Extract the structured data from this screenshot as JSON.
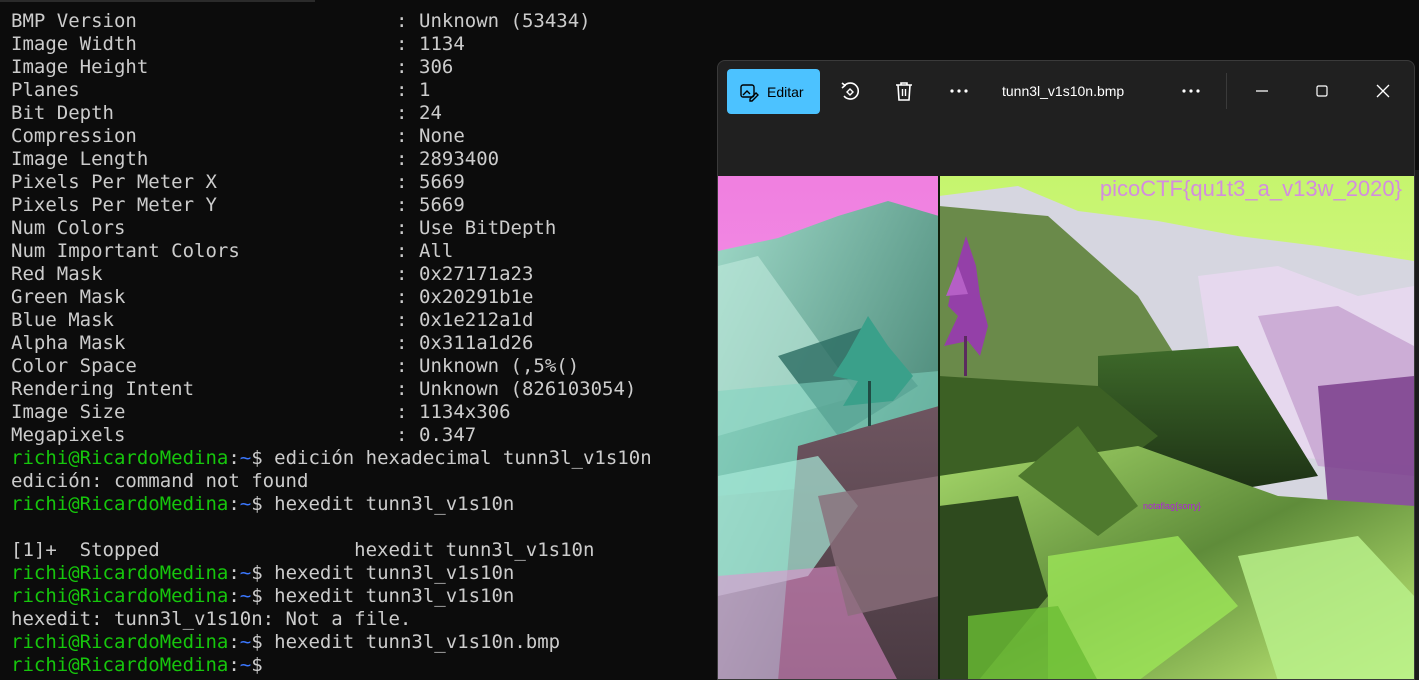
{
  "terminal": {
    "metadata": [
      {
        "key": "BMP Version",
        "value": "Unknown (53434)"
      },
      {
        "key": "Image Width",
        "value": "1134"
      },
      {
        "key": "Image Height",
        "value": "306"
      },
      {
        "key": "Planes",
        "value": "1"
      },
      {
        "key": "Bit Depth",
        "value": "24"
      },
      {
        "key": "Compression",
        "value": "None"
      },
      {
        "key": "Image Length",
        "value": "2893400"
      },
      {
        "key": "Pixels Per Meter X",
        "value": "5669"
      },
      {
        "key": "Pixels Per Meter Y",
        "value": "5669"
      },
      {
        "key": "Num Colors",
        "value": "Use BitDepth"
      },
      {
        "key": "Num Important Colors",
        "value": "All"
      },
      {
        "key": "Red Mask",
        "value": "0x27171a23"
      },
      {
        "key": "Green Mask",
        "value": "0x20291b1e"
      },
      {
        "key": "Blue Mask",
        "value": "0x1e212a1d"
      },
      {
        "key": "Alpha Mask",
        "value": "0x311a1d26"
      },
      {
        "key": "Color Space",
        "value": "Unknown (,5%()"
      },
      {
        "key": "Rendering Intent",
        "value": "Unknown (826103054)"
      },
      {
        "key": "Image Size",
        "value": "1134x306"
      },
      {
        "key": "Megapixels",
        "value": "0.347"
      }
    ],
    "separator": ":",
    "prompt": {
      "user": "richi@RicardoMedina",
      "colon": ":",
      "path": "~",
      "symbol": "$ "
    },
    "lines": [
      {
        "type": "prompt",
        "command": "edición hexadecimal tunn3l_v1s10n"
      },
      {
        "type": "output",
        "text": "edición: command not found"
      },
      {
        "type": "prompt",
        "command": "hexedit tunn3l_v1s10n"
      },
      {
        "type": "blank",
        "text": ""
      },
      {
        "type": "output",
        "text": "[1]+  Stopped                 hexedit tunn3l_v1s10n"
      },
      {
        "type": "prompt",
        "command": "hexedit tunn3l_v1s10n"
      },
      {
        "type": "prompt",
        "command": "hexedit tunn3l_v1s10n"
      },
      {
        "type": "output",
        "text": "hexedit: tunn3l_v1s10n: Not a file."
      },
      {
        "type": "prompt",
        "command": "hexedit tunn3l_v1s10n.bmp"
      },
      {
        "type": "prompt",
        "command": ""
      }
    ],
    "colors": {
      "user": "#16c60c",
      "path": "#3b78ff",
      "text": "#cccccc",
      "bg": "#0c0c0c"
    }
  },
  "viewer": {
    "edit_label": "Editar",
    "file_name": "tunn3l_v1s10n.bmp",
    "accent": "#4cc2ff",
    "icons": [
      "edit-image-icon",
      "rotate-icon",
      "delete-icon",
      "more-icon",
      "minimize-icon",
      "maximize-icon",
      "close-icon"
    ],
    "image": {
      "flag_text": "picoCTF{qu1t3_a_v13w_2020}",
      "notaflag_text": "notaflag{sorry}"
    }
  }
}
